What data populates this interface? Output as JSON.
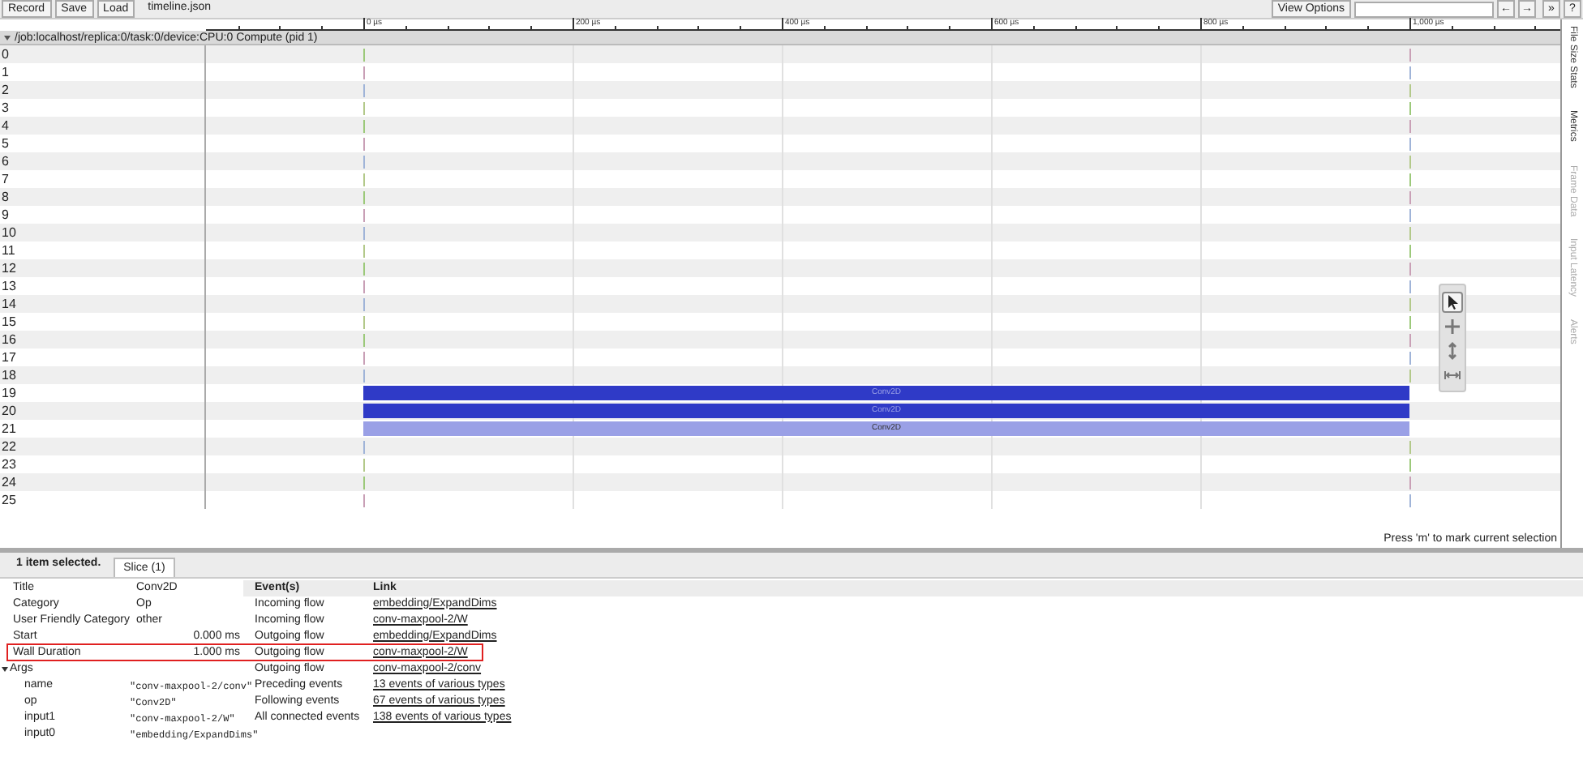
{
  "toolbar": {
    "buttons": [
      "Record",
      "Save",
      "Load"
    ],
    "file_name": "timeline.json",
    "view_options": "View Options",
    "nav_buttons": [
      "←",
      "→",
      "»",
      "?"
    ]
  },
  "ruler": {
    "ticks": [
      "0 µs",
      "200 µs",
      "400 µs",
      "600 µs",
      "800 µs",
      "1,000 µs"
    ]
  },
  "process": {
    "title": "/job:localhost/replica:0/task:0/device:CPU:0 Compute (pid 1)",
    "expanded": true
  },
  "rows": [
    {
      "label": "0"
    },
    {
      "label": "1"
    },
    {
      "label": "2"
    },
    {
      "label": "3"
    },
    {
      "label": "4"
    },
    {
      "label": "5"
    },
    {
      "label": "6"
    },
    {
      "label": "7"
    },
    {
      "label": "8"
    },
    {
      "label": "9"
    },
    {
      "label": "10"
    },
    {
      "label": "11"
    },
    {
      "label": "12"
    },
    {
      "label": "13"
    },
    {
      "label": "14"
    },
    {
      "label": "15"
    },
    {
      "label": "16"
    },
    {
      "label": "17"
    },
    {
      "label": "18"
    },
    {
      "label": "19",
      "slices": [
        {
          "name": "Conv2D",
          "selected": false
        }
      ]
    },
    {
      "label": "20",
      "slices": [
        {
          "name": "Conv2D",
          "selected": false
        }
      ]
    },
    {
      "label": "21",
      "slices": [
        {
          "name": "Conv2D",
          "selected": true
        }
      ]
    },
    {
      "label": "22"
    },
    {
      "label": "23"
    },
    {
      "label": "24"
    },
    {
      "label": "25"
    }
  ],
  "tools": [
    {
      "kind": "select",
      "selected": true
    },
    {
      "kind": "pan",
      "selected": false
    },
    {
      "kind": "zoom",
      "selected": false
    },
    {
      "kind": "timing",
      "selected": false
    }
  ],
  "side_tabs": [
    "File Size Stats",
    "Metrics",
    "Frame Data",
    "Input Latency",
    "Alerts"
  ],
  "status": "Press 'm' to mark current selection",
  "details": {
    "summary": "1 item selected.",
    "tabs": [
      {
        "label": "Slice (1)",
        "selected": true
      }
    ],
    "properties": [
      {
        "label": "Title",
        "value": "Conv2D"
      },
      {
        "label": "Category",
        "value": "Op"
      },
      {
        "label": "User Friendly Category",
        "value": "other"
      },
      {
        "label": "Start",
        "value": "0.000 ms",
        "kind": "number"
      },
      {
        "label": "Wall Duration",
        "value": "1.000 ms",
        "kind": "number",
        "highlighted": true
      }
    ],
    "args": {
      "label": "Args",
      "expanded": true,
      "children": [
        {
          "label": "name",
          "value": "\"conv-maxpool-2/conv\""
        },
        {
          "label": "op",
          "value": "\"Conv2D\""
        },
        {
          "label": "input1",
          "value": "\"conv-maxpool-2/W\""
        },
        {
          "label": "input0",
          "value": "\"embedding/ExpandDims\""
        }
      ]
    },
    "events": {
      "columns": [
        "Event(s)",
        "Link"
      ],
      "rows": [
        {
          "event": "Incoming flow",
          "link": "embedding/ExpandDims"
        },
        {
          "event": "Incoming flow",
          "link": "conv-maxpool-2/W"
        },
        {
          "event": "Outgoing flow",
          "link": "embedding/ExpandDims"
        },
        {
          "event": "Outgoing flow",
          "link": "conv-maxpool-2/W"
        },
        {
          "event": "Outgoing flow",
          "link": "conv-maxpool-2/conv"
        },
        {
          "event": "Preceding events",
          "link": "13 events of various types"
        },
        {
          "event": "Following events",
          "link": "67 events of various types"
        },
        {
          "event": "All connected events",
          "link": "138 events of various types"
        }
      ]
    }
  }
}
